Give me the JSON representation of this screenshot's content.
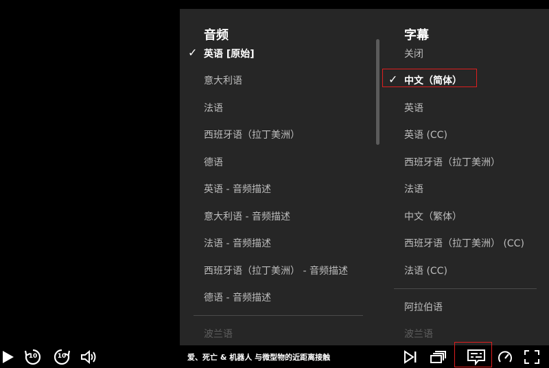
{
  "audio": {
    "title": "音频",
    "items": [
      {
        "label": "英语 [原始]",
        "selected": true
      },
      {
        "label": "意大利语"
      },
      {
        "label": "法语"
      },
      {
        "label": "西班牙语（拉丁美洲）"
      },
      {
        "label": "德语"
      },
      {
        "label": "英语 - 音频描述"
      },
      {
        "label": "意大利语 - 音频描述"
      },
      {
        "label": "法语 - 音频描述"
      },
      {
        "label": "西班牙语（拉丁美洲） - 音频描述"
      },
      {
        "label": "德语 - 音频描述"
      },
      {
        "label": "波兰语"
      }
    ]
  },
  "subtitles": {
    "title": "字幕",
    "items": [
      {
        "label": "关闭"
      },
      {
        "label": "中文（简体）",
        "selected": true
      },
      {
        "label": "英语"
      },
      {
        "label": "英语 (CC)"
      },
      {
        "label": "西班牙语（拉丁美洲）"
      },
      {
        "label": "法语"
      },
      {
        "label": "中文（繁体）"
      },
      {
        "label": "西班牙语（拉丁美洲）  (CC)"
      },
      {
        "label": "法语 (CC)"
      },
      {
        "label": "阿拉伯语"
      },
      {
        "label": "波兰语"
      }
    ]
  },
  "player": {
    "title": "爱、死亡 & 机器人 与微型物的近距离接触",
    "rewind_seconds": "10",
    "forward_seconds": "10"
  },
  "icons": {
    "play": "play-icon",
    "rewind": "rewind-10-icon",
    "forward": "forward-10-icon",
    "volume": "volume-icon",
    "next": "next-episode-icon",
    "episodes": "episodes-icon",
    "subtitles": "subtitles-icon",
    "speed": "speed-icon",
    "fullscreen": "fullscreen-icon"
  },
  "colors": {
    "panel_bg": "#262626",
    "highlight": "#e01e1e"
  }
}
